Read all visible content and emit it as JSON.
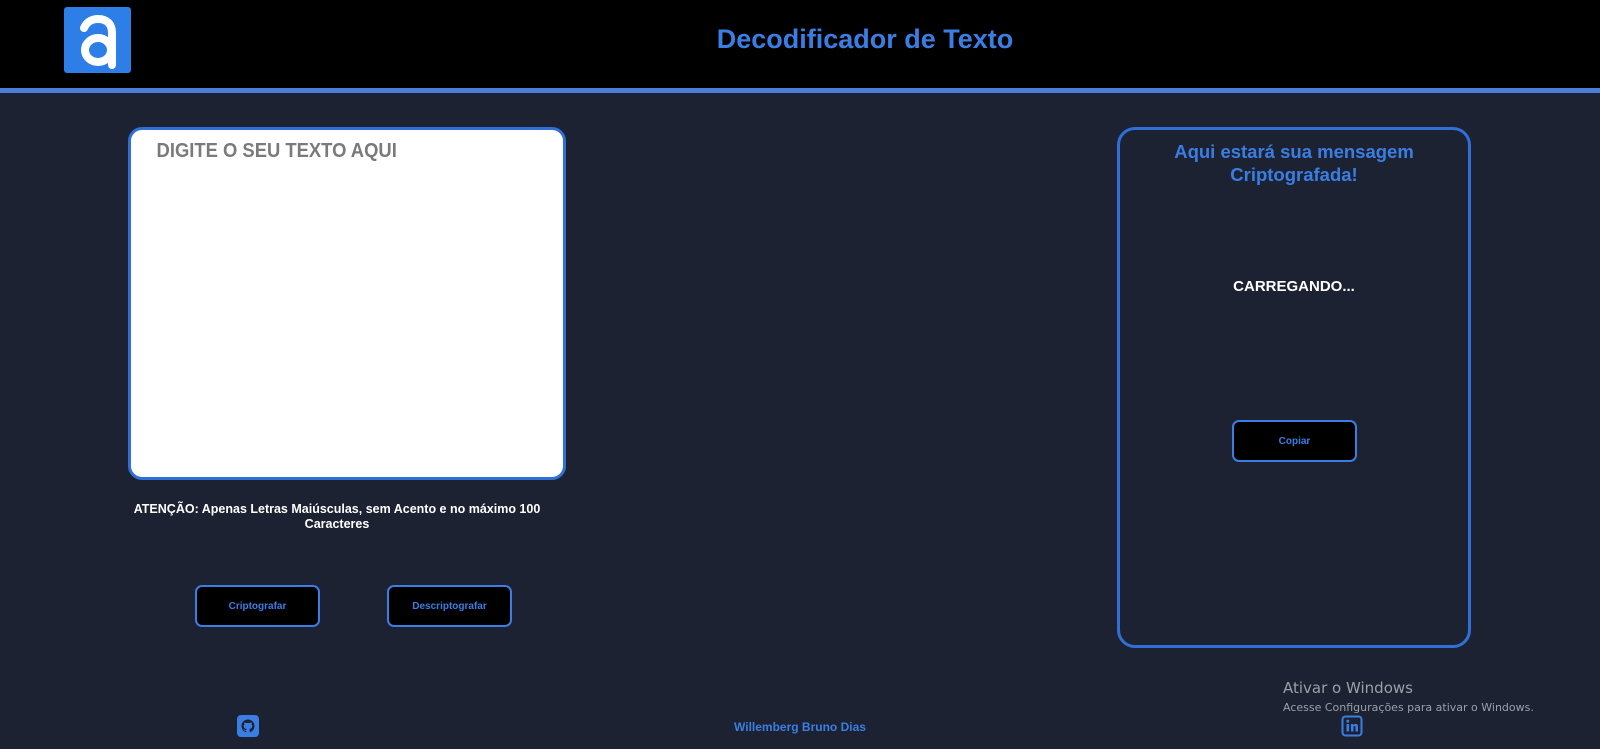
{
  "header": {
    "title": "Decodificador de Texto",
    "logo_icon": "a-letter-logo-icon"
  },
  "input": {
    "placeholder": "DIGITE O SEU TEXTO AQUI",
    "value": ""
  },
  "warning": "ATENÇÃO: Apenas Letras Maiúsculas, sem Acento e no máximo 100 Caracteres",
  "buttons": {
    "encrypt_label": "Criptografar",
    "decrypt_label": "Descriptografar"
  },
  "output": {
    "title": "Aqui estará sua mensagem Criptografada!",
    "status": "CARREGANDO...",
    "copy_label": "Copiar"
  },
  "windows_activation": {
    "title": "Ativar o Windows",
    "subtitle": "Acesse Configurações para ativar o Windows."
  },
  "footer": {
    "author": "Willemberg Bruno Dias",
    "github_icon": "github-icon",
    "linkedin_icon": "linkedin-icon"
  },
  "colors": {
    "background": "#1d2232",
    "header": "#000000",
    "accent": "#3a7ee3",
    "logo": "#2d7ee6"
  }
}
